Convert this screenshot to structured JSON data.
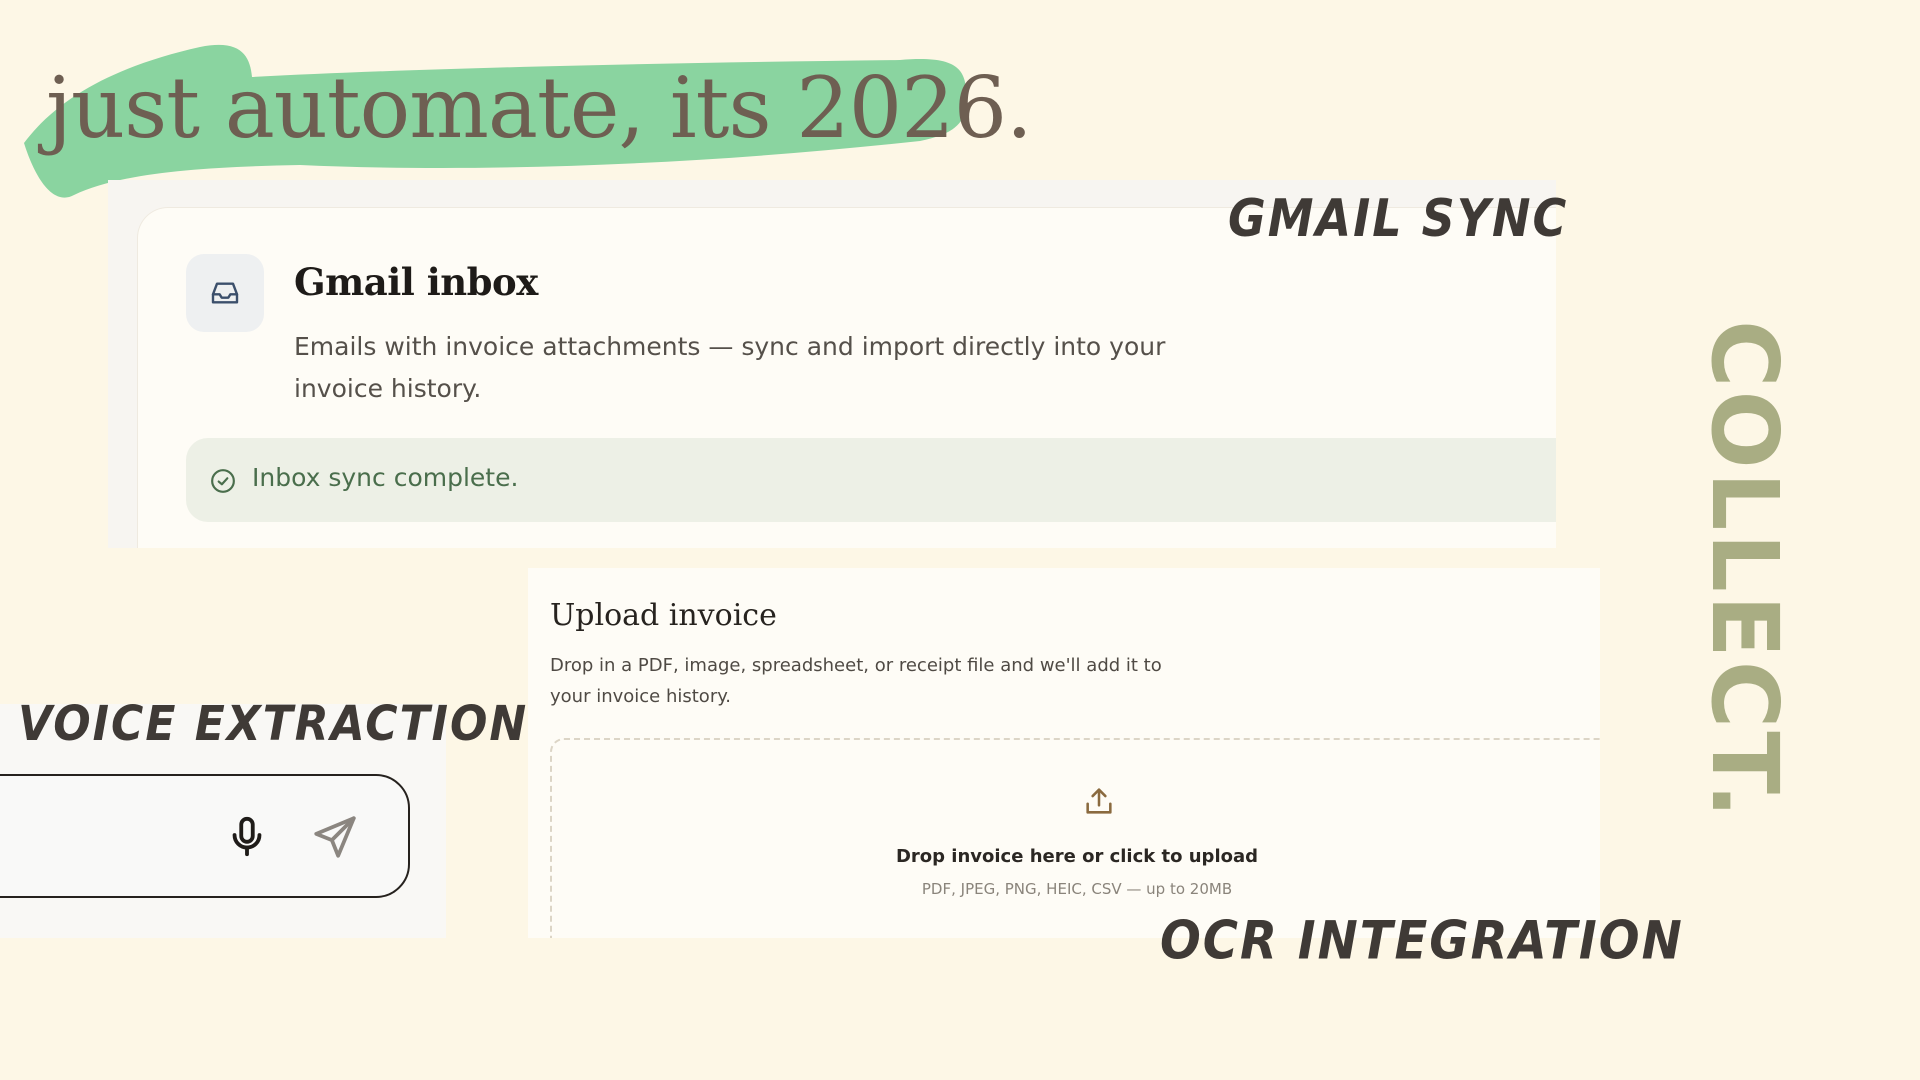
{
  "headline": "just automate, its 2026.",
  "labels": {
    "gmail_sync": "GMAIL SYNC",
    "collect": "COLLECT.",
    "voice_extraction": "VOICE EXTRACTION",
    "ocr_integration": "OCR INTEGRATION"
  },
  "gmail_card": {
    "icon": "inbox-icon",
    "title": "Gmail inbox",
    "description": "Emails with invoice attachments — sync and import directly into your invoice history.",
    "status_icon": "check-circle-icon",
    "status_text": "Inbox sync complete."
  },
  "upload_card": {
    "title": "Upload invoice",
    "description": "Drop in a PDF, image, spreadsheet, or receipt file and we'll add it to your invoice history.",
    "dropzone": {
      "icon": "upload-icon",
      "label": "Drop invoice here or click to upload",
      "hint": "PDF, JPEG, PNG, HEIC, CSV — up to 20MB"
    }
  },
  "voice_input": {
    "mic_icon": "microphone-icon",
    "send_icon": "send-icon"
  },
  "colors": {
    "background": "#fdf7e6",
    "brush_green": "#8ad4a0",
    "headline_text": "#6e5f52",
    "collect_text": "#a9ad83",
    "status_green": "#4a6e4c",
    "status_bg": "#edf0e6"
  }
}
